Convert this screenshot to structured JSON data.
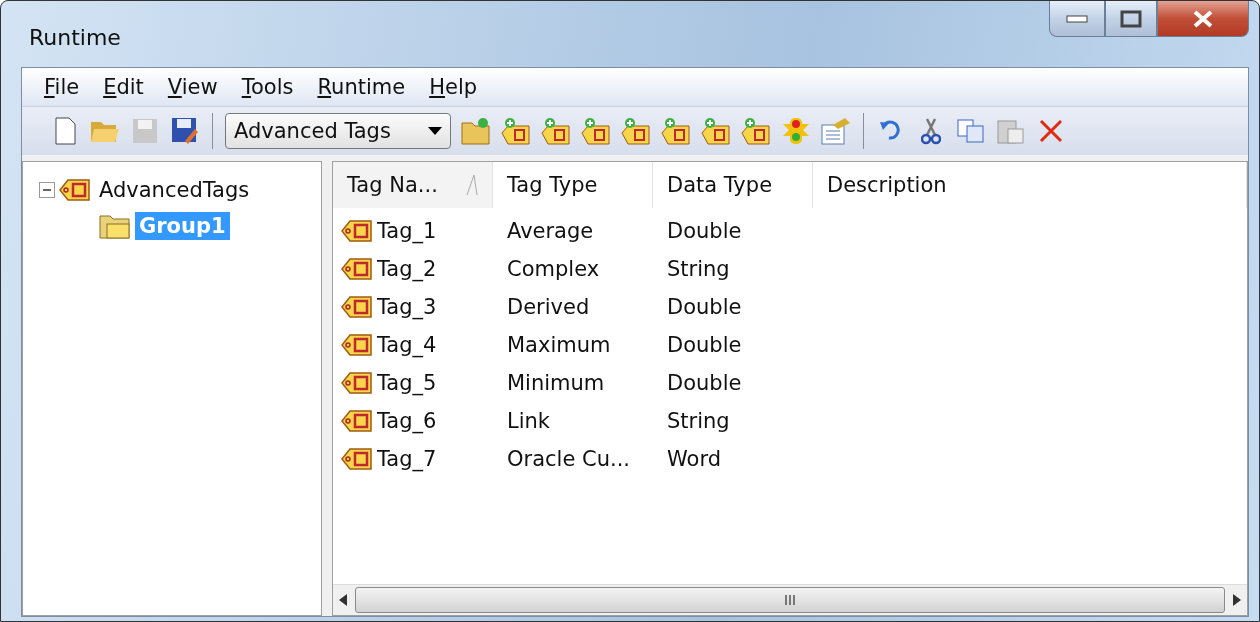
{
  "window": {
    "title": "Runtime"
  },
  "menu": [
    "File",
    "Edit",
    "View",
    "Tools",
    "Runtime",
    "Help"
  ],
  "toolbar": {
    "selector": {
      "value": "Advanced Tags"
    }
  },
  "tree": {
    "items": [
      {
        "label": "AdvancedTags",
        "expanded": true,
        "selected": false,
        "children": [
          {
            "label": "Group1",
            "selected": true
          }
        ]
      }
    ]
  },
  "table": {
    "columns": [
      "Tag Na...",
      "Tag Type",
      "Data Type",
      "Description"
    ],
    "rows": [
      {
        "cells": [
          "Tag_1",
          "Average",
          "Double",
          ""
        ]
      },
      {
        "cells": [
          "Tag_2",
          "Complex",
          "String",
          ""
        ]
      },
      {
        "cells": [
          "Tag_3",
          "Derived",
          "Double",
          ""
        ]
      },
      {
        "cells": [
          "Tag_4",
          "Maximum",
          "Double",
          ""
        ]
      },
      {
        "cells": [
          "Tag_5",
          "Minimum",
          "Double",
          ""
        ]
      },
      {
        "cells": [
          "Tag_6",
          "Link",
          "String",
          ""
        ]
      },
      {
        "cells": [
          "Tag_7",
          "Oracle Cu...",
          "Word",
          ""
        ]
      }
    ]
  }
}
